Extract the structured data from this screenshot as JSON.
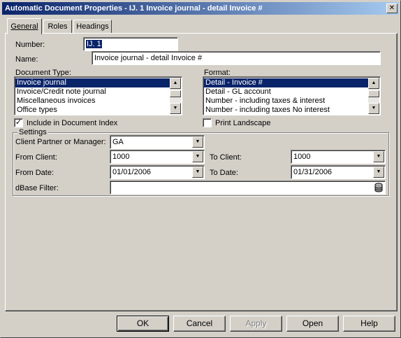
{
  "window": {
    "title": "Automatic Document Properties - IJ. 1 Invoice journal - detail Invoice #",
    "close_glyph": "✕"
  },
  "tabs": [
    {
      "label": "General",
      "active": true
    },
    {
      "label": "Roles",
      "active": false
    },
    {
      "label": "Headings",
      "active": false
    }
  ],
  "general": {
    "number_label": "Number:",
    "number_value": "IJ. 1",
    "name_label": "Name:",
    "name_value": "Invoice journal - detail Invoice #",
    "document_type_label": "Document Type:",
    "document_types": [
      {
        "label": "Invoice journal",
        "selected": true
      },
      {
        "label": "Invoice/Credit note journal",
        "selected": false
      },
      {
        "label": "Miscellaneous invoices",
        "selected": false
      },
      {
        "label": "Office types",
        "selected": false
      }
    ],
    "format_label": "Format:",
    "formats": [
      {
        "label": "Detail - Invoice #",
        "selected": true
      },
      {
        "label": "Detail - GL account",
        "selected": false
      },
      {
        "label": "Number - including taxes & interest",
        "selected": false
      },
      {
        "label": "Number - including taxes No interest",
        "selected": false
      }
    ],
    "include_in_index_label": "Include in Document Index",
    "include_in_index_checked": true,
    "print_landscape_label": "Print Landscape",
    "print_landscape_checked": false
  },
  "settings": {
    "group_title": "Settings",
    "client_partner_label": "Client Partner or Manager:",
    "client_partner_value": "GA",
    "from_client_label": "From Client:",
    "from_client_value": "1000",
    "to_client_label": "To Client:",
    "to_client_value": "1000",
    "from_date_label": "From Date:",
    "from_date_value": "01/01/2006",
    "to_date_label": "To Date:",
    "to_date_value": "01/31/2006",
    "dbase_filter_label": "dBase Filter:",
    "dbase_filter_value": ""
  },
  "buttons": {
    "ok": "OK",
    "cancel": "Cancel",
    "apply": "Apply",
    "open": "Open",
    "help": "Help"
  },
  "icons": {
    "dropdown_arrow": "▼",
    "scroll_up": "▲",
    "scroll_down": "▼",
    "checkmark": "✓"
  }
}
